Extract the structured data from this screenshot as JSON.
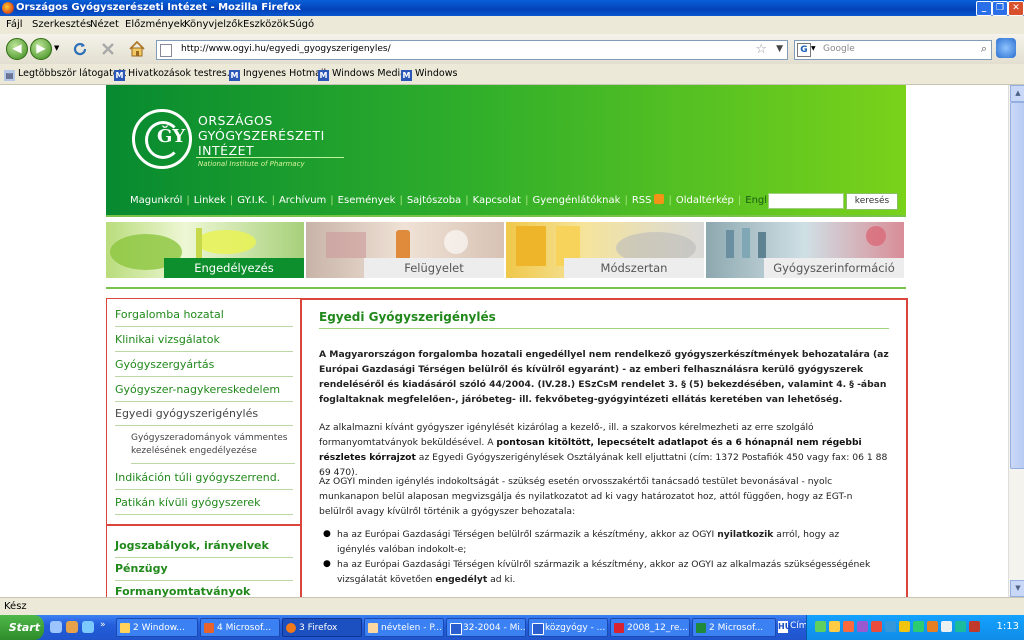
{
  "window": {
    "title": "Országos Gyógyszerészeti Intézet - Mozilla Firefox",
    "controls": {
      "minimize": "_",
      "restore": "❐",
      "close": "✕"
    }
  },
  "menu": [
    "Fájl",
    "Szerkesztés",
    "Nézet",
    "Előzmények",
    "Könyvjelzők",
    "Eszközök",
    "Súgó"
  ],
  "toolbar": {
    "back_glyph": "◀",
    "forward_glyph": "▶",
    "url": "http://www.ogyi.hu/egyedi_gyogyszerigenyles/",
    "search_placeholder": "Google",
    "search_engine_glyph": "G",
    "icons": {
      "reload": "reload-icon",
      "stop": "stop-icon",
      "home": "home-icon"
    }
  },
  "bookmarks": [
    "Legtöbbször látogatott",
    "Hivatkozások testres...",
    "Ingyenes Hotmail",
    "Windows Media",
    "Windows"
  ],
  "header": {
    "org_line1": "ORSZÁGOS",
    "org_line2": "GYÓGYSZERÉSZETI",
    "org_line3": "INTÉZET",
    "org_en": "National Institute of Pharmacy",
    "logo_letters": "ǦY"
  },
  "topnav": [
    "Magunkról",
    "Linkek",
    "GY.I.K.",
    "Archívum",
    "Események",
    "Sajtószoba",
    "Kapcsolat",
    "Gyengénlátóknak",
    "RSS",
    "Oldaltérkép",
    "English"
  ],
  "search": {
    "button": "keresés",
    "value": ""
  },
  "banners": [
    "Engedélyezés",
    "Felügyelet",
    "Módszertan",
    "Gyógyszerinformáció"
  ],
  "sidebar": {
    "items": [
      "Forgalomba hozatal",
      "Klinikai vizsgálatok",
      "Gyógyszergyártás",
      "Gyógyszer-nagykereskedelem",
      "Egyedi gyógyszerigénylés"
    ],
    "subitem": "Gyógyszeradományok vámmentes kezelésének engedélyezése",
    "items2": [
      "Indikáción túli gyógyszerrend.",
      "Patikán kívüli gyógyszerek"
    ],
    "bold_items": [
      "Jogszabályok, irányelvek",
      "Pénzügy",
      "Formanyomtatványok"
    ]
  },
  "main": {
    "title": "Egyedi Gyógyszerigénylés",
    "p1": "A Magyarországon forgalomba hozatali engedéllyel nem rendelkező gyógyszerkészítmények behozatalára (az Európai Gazdasági Térségen belülről és kívülről egyaránt) - az emberi felhasználásra kerülő gyógyszerek rendeléséről és kiadásáról szóló 44/2004. (IV.28.) ESzCsM rendelet 3. § (5) bekezdésében, valamint 4. § -ában foglaltaknak megfelelően-, járóbeteg- ill. fekvőbeteg-gyógyintézeti ellátás keretében van lehetőség.",
    "p2_a": "Az alkalmazni kívánt gyógyszer igénylését kizárólag a kezelő-, ill. a szakorvos kérelmezheti az erre szolgáló formanyomtatványok beküldésével. A ",
    "p2_b": "pontosan kitöltött, lepecsételt adatlapot és a 6 hónapnál nem régebbi részletes kórrajzot",
    "p2_c": " az Egyedi Gyógyszerigénylések Osztályának kell eljuttatni (cím: 1372 Postafiók 450 vagy fax: 06 1 88 69 470).",
    "p3": "Az OGYI minden igénylés indokoltságát - szükség esetén orvosszakértői tanácsadó testület bevonásával - nyolc munkanapon belül alaposan megvizsgálja és nyilatkozatot ad ki vagy határozatot hoz, attól függően, hogy az EGT-n belülről avagy kívülről történik a gyógyszer behozatala:",
    "li1_a": "ha az Európai Gazdasági Térségen belülről származik a készítmény, akkor az OGYI ",
    "li1_b": "nyilatkozik",
    "li1_c": " arról, hogy az igénylés valóban indokolt-e;",
    "li2_a": "ha az Európai Gazdasági Térségen kívülről származik a készítmény, akkor az OGYI az alkalmazás szükségességének vizsgálatát követően ",
    "li2_b": "engedélyt",
    "li2_c": " ad ki.",
    "bullet": "●"
  },
  "status": "Kész",
  "taskbar": {
    "start": "Start",
    "tasks": [
      "2 Window...",
      "4 Microsof...",
      "3 Firefox",
      "névtelen - P...",
      "32-2004 - Mi...",
      "közgyógy - ...",
      "2008_12_re...",
      "2 Microsof..."
    ],
    "address_label": "Cím",
    "clock": "1:13"
  }
}
